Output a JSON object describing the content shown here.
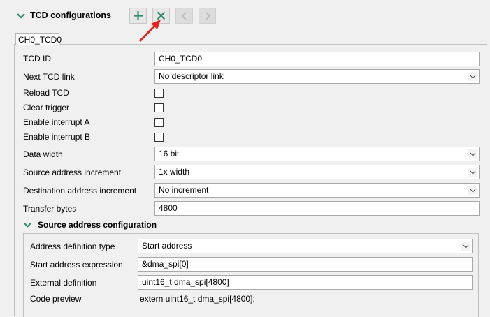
{
  "section": {
    "title": "TCD configurations",
    "add_tooltip": "add",
    "toolbar": [
      "add-icon",
      "remove-icon",
      "previous-icon",
      "next-icon"
    ]
  },
  "tab": {
    "label": "CH0_TCD0"
  },
  "fields": {
    "tcd_id": {
      "label": "TCD ID",
      "value": "CH0_TCD0"
    },
    "next_link": {
      "label": "Next TCD link",
      "value": "No descriptor link"
    },
    "reload": {
      "label": "Reload TCD"
    },
    "clear_trigger": {
      "label": "Clear trigger"
    },
    "int_a": {
      "label": "Enable interrupt A"
    },
    "int_b": {
      "label": "Enable interrupt B"
    },
    "data_width": {
      "label": "Data width",
      "value": "16 bit"
    },
    "src_inc": {
      "label": "Source address increment",
      "value": "1x width"
    },
    "dst_inc": {
      "label": "Destination address increment",
      "value": "No increment"
    },
    "transfer": {
      "label": "Transfer bytes",
      "value": "4800"
    }
  },
  "source": {
    "title": "Source address configuration",
    "def_type": {
      "label": "Address definition type",
      "value": "Start address"
    },
    "start_expr": {
      "label": "Start address expression",
      "value": "&dma_spi[0]"
    },
    "ext_def": {
      "label": "External definition",
      "value": "uint16_t dma_spi[4800]"
    },
    "preview": {
      "label": "Code preview",
      "value": "extern uint16_t dma_spi[4800];"
    }
  },
  "colors": {
    "accent": "#2e8b6e",
    "arrow": "#e8231f"
  }
}
